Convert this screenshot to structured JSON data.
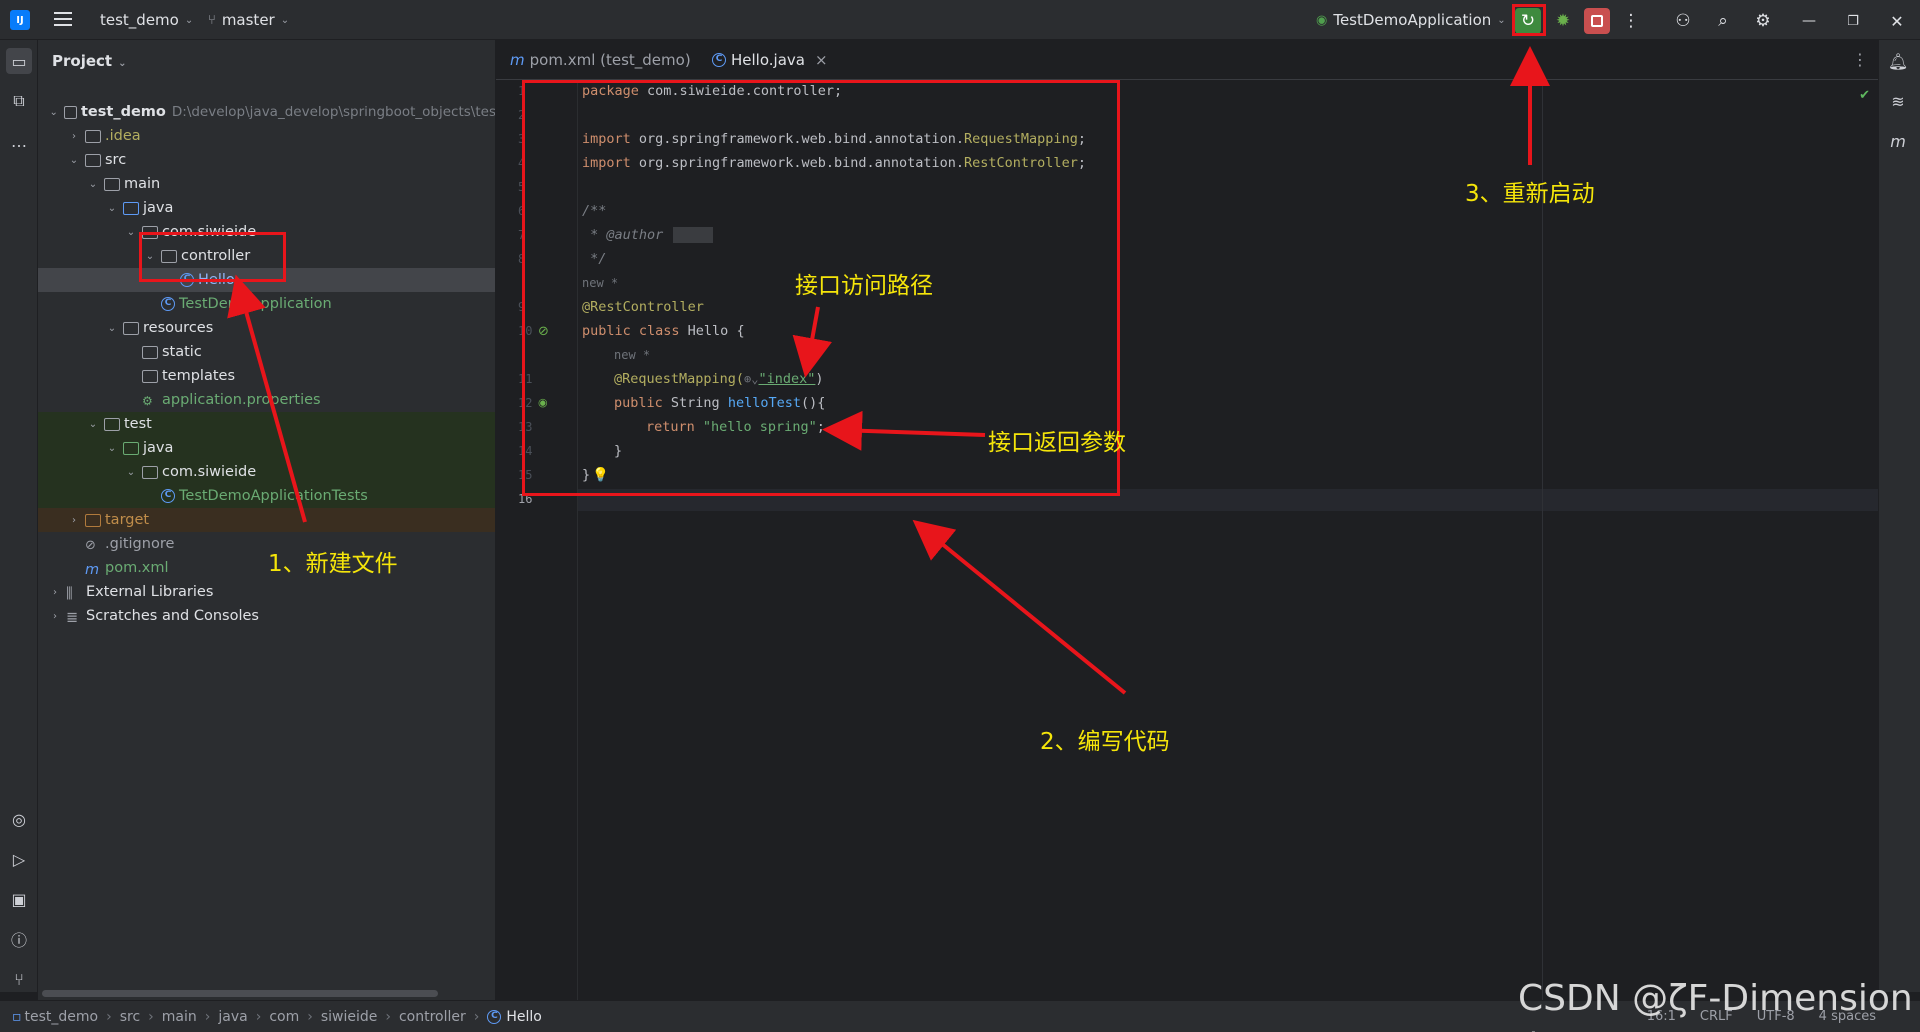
{
  "titlebar": {
    "project": "test_demo",
    "branch": "master",
    "run_config": "TestDemoApplication"
  },
  "project_panel": {
    "title": "Project",
    "tree": [
      {
        "name": "test_demo",
        "path": "D:\\develop\\java_develop\\springboot_objects\\tes",
        "depth": 0,
        "icon": "folder",
        "expanded": true
      },
      {
        "name": ".idea",
        "depth": 1,
        "icon": "folder",
        "expanded": false
      },
      {
        "name": "src",
        "depth": 1,
        "icon": "folder",
        "expanded": true
      },
      {
        "name": "main",
        "depth": 2,
        "icon": "folder",
        "expanded": true
      },
      {
        "name": "java",
        "depth": 3,
        "icon": "folder-blue",
        "expanded": true
      },
      {
        "name": "com.siwieide",
        "depth": 4,
        "icon": "package",
        "expanded": true
      },
      {
        "name": "controller",
        "depth": 5,
        "icon": "package",
        "expanded": true
      },
      {
        "name": "Hello",
        "depth": 6,
        "icon": "class",
        "selected": true
      },
      {
        "name": "TestDemoApplication",
        "depth": 5,
        "icon": "class-app"
      },
      {
        "name": "resources",
        "depth": 3,
        "icon": "folder-res",
        "expanded": true
      },
      {
        "name": "static",
        "depth": 4,
        "icon": "folder"
      },
      {
        "name": "templates",
        "depth": 4,
        "icon": "folder"
      },
      {
        "name": "application.properties",
        "depth": 4,
        "icon": "properties"
      },
      {
        "name": "test",
        "depth": 2,
        "icon": "folder",
        "expanded": true
      },
      {
        "name": "java",
        "depth": 3,
        "icon": "folder-green",
        "expanded": true
      },
      {
        "name": "com.siwieide",
        "depth": 4,
        "icon": "package",
        "expanded": true
      },
      {
        "name": "TestDemoApplicationTests",
        "depth": 5,
        "icon": "class-test"
      },
      {
        "name": "target",
        "depth": 1,
        "icon": "folder-orange",
        "expanded": false
      },
      {
        "name": ".gitignore",
        "depth": 1,
        "icon": "ignore"
      },
      {
        "name": "pom.xml",
        "depth": 1,
        "icon": "maven"
      },
      {
        "name": "External Libraries",
        "depth": 0,
        "icon": "libs",
        "expanded": false
      },
      {
        "name": "Scratches and Consoles",
        "depth": 0,
        "icon": "scratch",
        "expanded": false
      }
    ]
  },
  "tabs": [
    {
      "label": "pom.xml (test_demo)",
      "icon": "maven-icon",
      "active": false
    },
    {
      "label": "Hello.java",
      "icon": "class-icon",
      "active": true,
      "close": "×"
    }
  ],
  "code": {
    "line_numbers": [
      "1",
      "2",
      "3",
      "4",
      "5",
      "6",
      "7",
      "8",
      "",
      "9",
      "10",
      "",
      "11",
      "12",
      "13",
      "14",
      "15",
      "16"
    ],
    "l1_kw": "package",
    "l1_rest": " com.siwieide.controller;",
    "l3_kw": "import",
    "l3_pkg": " org.springframework.web.bind.annotation.",
    "l3_cls": "RequestMapping",
    "l3_end": ";",
    "l4_kw": "import",
    "l4_pkg": " org.springframework.web.bind.annotation.",
    "l4_cls": "RestController",
    "l4_end": ";",
    "l6": "/**",
    "l7_a": " * ",
    "l7_tag": "@author",
    "l8": " */",
    "hint1": "new *",
    "l9": "@RestController",
    "l10_kw": "public class",
    "l10_rest": " Hello {",
    "hint2": "new *",
    "l11_ann": "@RequestMapping(",
    "l11_icon": "⊕⌄",
    "l11_str": "\"index\"",
    "l11_end": ")",
    "l12_kw": "public",
    "l12_type": " String ",
    "l12_fn": "helloTest",
    "l12_end": "(){",
    "l13_kw": "return",
    "l13_str": " \"hello spring\"",
    "l13_end": ";",
    "l14": "}",
    "l15": "}"
  },
  "statusbar": {
    "breadcrumb": [
      "test_demo",
      "src",
      "main",
      "java",
      "com",
      "siwieide",
      "controller",
      "Hello"
    ],
    "position": "16:1",
    "line_sep": "CRLF",
    "encoding": "UTF-8",
    "indent": "4 spaces"
  },
  "annotations": {
    "a1": "1、新建文件",
    "a2": "2、编写代码",
    "a3": "3、重新启动",
    "path": "接口访问路径",
    "ret": "接口返回参数"
  },
  "watermark": "CSDN @ζF-Dimension あ",
  "colors": {
    "annotation": "#f5e50a",
    "arrow": "#e8151b",
    "run": "#4f9e4d",
    "stop": "#d94f4f"
  }
}
